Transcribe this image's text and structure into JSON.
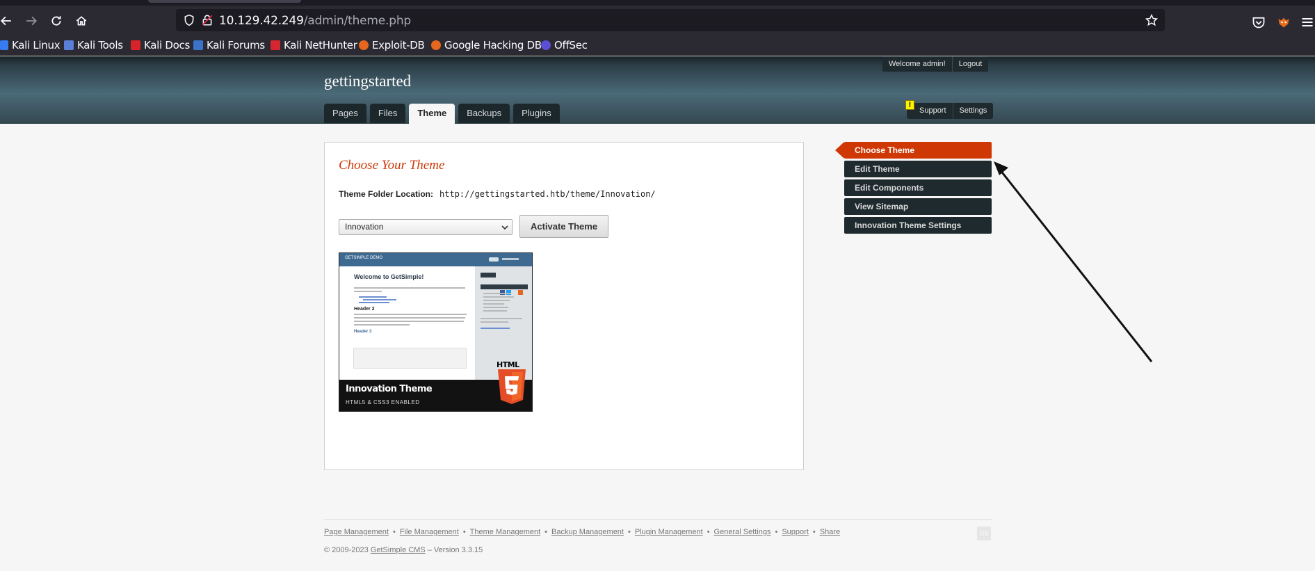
{
  "browser": {
    "url_host": "10.129.42.249",
    "url_path": "/admin/theme.php",
    "bookmarks": [
      {
        "label": "Kali Linux",
        "icon": "kali-dragon-icon"
      },
      {
        "label": "Kali Tools",
        "icon": "kali-tools-icon"
      },
      {
        "label": "Kali Docs",
        "icon": "kali-docs-icon"
      },
      {
        "label": "Kali Forums",
        "icon": "kali-forums-icon"
      },
      {
        "label": "Kali NetHunter",
        "icon": "nethunter-icon"
      },
      {
        "label": "Exploit-DB",
        "icon": "exploitdb-icon"
      },
      {
        "label": "Google Hacking DB",
        "icon": "ghdb-icon"
      },
      {
        "label": "OffSec",
        "icon": "offsec-icon"
      }
    ]
  },
  "header": {
    "site_name": "gettingstarted",
    "welcome": "Welcome admin!",
    "logout": "Logout",
    "tabs": [
      {
        "label": "Pages",
        "active": false
      },
      {
        "label": "Files",
        "active": false
      },
      {
        "label": "Theme",
        "active": true
      },
      {
        "label": "Backups",
        "active": false
      },
      {
        "label": "Plugins",
        "active": false
      }
    ],
    "support": "Support",
    "settings": "Settings",
    "warning_glyph": "!"
  },
  "main": {
    "title": "Choose Your Theme",
    "folder_label": "Theme Folder Location:",
    "folder_value": "http://gettingstarted.htb/theme/Innovation/",
    "select_value": "Innovation",
    "activate_button": "Activate Theme",
    "preview": {
      "site_title": "GETSIMPLE DEMO",
      "heading": "Welcome to GetSimple!",
      "header2": "Header 2",
      "header3": "Header 3",
      "theme_name": "Innovation Theme",
      "theme_sub": "HTML5 & CSS3 ENABLED",
      "html5_label": "HTML"
    }
  },
  "sidebar": {
    "items": [
      {
        "label": "Choose Theme",
        "current": true
      },
      {
        "label": "Edit Theme",
        "current": false
      },
      {
        "label": "Edit Components",
        "current": false
      },
      {
        "label": "View Sitemap",
        "current": false
      },
      {
        "label": "Innovation Theme Settings",
        "current": false
      }
    ]
  },
  "footer": {
    "links": [
      "Page Management",
      "File Management",
      "Theme Management",
      "Backup Management",
      "Plugin Management",
      "General Settings",
      "Support",
      "Share"
    ],
    "copyright_prefix": "© 2009-2023 ",
    "copyright_link": "GetSimple CMS",
    "copyright_suffix": " – Version 3.3.15",
    "logo_text": "GS"
  },
  "colors": {
    "accent": "#cf3805",
    "header_dark": "#1f2a2f",
    "browser_bg": "#2b2a33"
  }
}
